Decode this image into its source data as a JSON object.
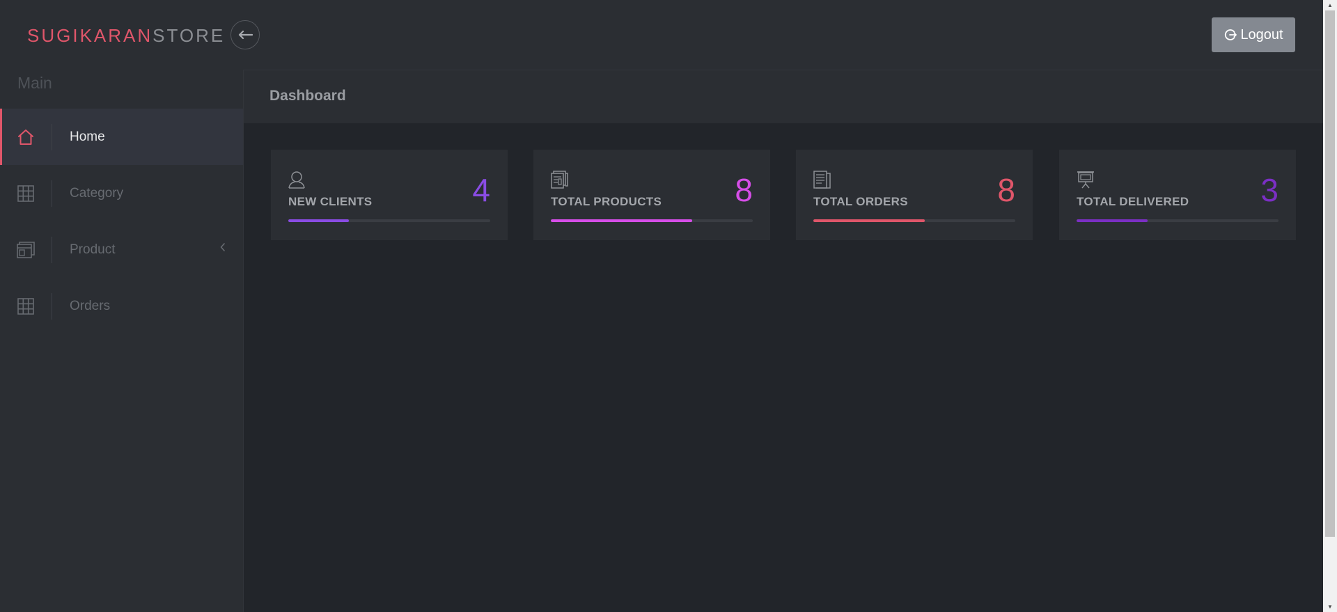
{
  "brand": {
    "part1": "SUGIKARAN",
    "part2": "STORE",
    "color_primary": "#e0566a",
    "color_secondary": "#8b8e93"
  },
  "header": {
    "logout_label": "Logout"
  },
  "sidebar": {
    "section_title": "Main",
    "items": [
      {
        "label": "Home",
        "icon": "home-icon",
        "active": true
      },
      {
        "label": "Category",
        "icon": "grid-icon",
        "active": false
      },
      {
        "label": "Product",
        "icon": "window-icon",
        "active": false,
        "has_submenu": true
      },
      {
        "label": "Orders",
        "icon": "grid-icon",
        "active": false
      }
    ]
  },
  "main": {
    "page_title": "Dashboard"
  },
  "stats": [
    {
      "label": "NEW CLIENTS",
      "value": "4",
      "icon": "user-icon",
      "color": "#8a4ce4",
      "progress": 0.3
    },
    {
      "label": "TOTAL PRODUCTS",
      "value": "8",
      "icon": "product-icon",
      "color": "#d64ee8",
      "progress": 0.7
    },
    {
      "label": "TOTAL ORDERS",
      "value": "8",
      "icon": "document-icon",
      "color": "#e0566a",
      "progress": 0.55
    },
    {
      "label": "TOTAL DELIVERED",
      "value": "3",
      "icon": "presentation-icon",
      "color": "#7b2fc4",
      "progress": 0.35
    }
  ]
}
